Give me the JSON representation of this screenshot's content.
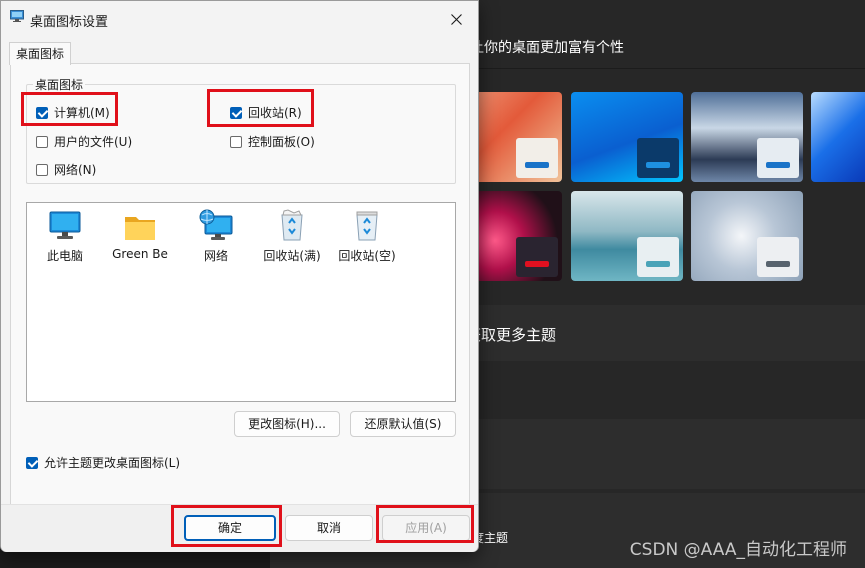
{
  "background": {
    "header_text": "让你的桌面更加富有个性",
    "more_themes": "获取更多主题",
    "contrast_themes": "对比度主题",
    "watermark": "CSDN @AAA_自动化工程师",
    "colors": {
      "panel": "#272727",
      "row": "#2d2d2d"
    },
    "themes": [
      {
        "name": "orange-theme",
        "bar": "#1a73c8",
        "card": "#f2eee8"
      },
      {
        "name": "blue-theme",
        "bar": "#1e90e0",
        "card": "#0b3a6a"
      },
      {
        "name": "mountain-theme",
        "bar": "#1a73c8",
        "card": "#e6ecf2"
      },
      {
        "name": "bloom-theme",
        "bar": "#1a73c8",
        "card": "#e9eef6"
      },
      {
        "name": "flower-theme",
        "bar": "#e01020",
        "card": "#2a2430"
      },
      {
        "name": "lake-theme",
        "bar": "#4aa3b8",
        "card": "#e8eff2"
      },
      {
        "name": "silver-theme",
        "bar": "#58636e",
        "card": "#edeff2"
      }
    ]
  },
  "dialog": {
    "title": "桌面图标设置",
    "tab": "桌面图标",
    "group_label": "桌面图标",
    "checkboxes": {
      "computer": {
        "label": "计算机(M)",
        "checked": true
      },
      "recycle_bin": {
        "label": "回收站(R)",
        "checked": true
      },
      "user_files": {
        "label": "用户的文件(U)",
        "checked": false
      },
      "control_panel": {
        "label": "控制面板(O)",
        "checked": false
      },
      "network": {
        "label": "网络(N)",
        "checked": false
      }
    },
    "icons": [
      {
        "label": "此电脑",
        "icon": "monitor-icon"
      },
      {
        "label": "Green Be",
        "icon": "folder-icon"
      },
      {
        "label": "网络",
        "icon": "network-icon"
      },
      {
        "label": "回收站(满)",
        "icon": "recycle-bin-full-icon"
      },
      {
        "label": "回收站(空)",
        "icon": "recycle-bin-empty-icon"
      }
    ],
    "change_icon_button": "更改图标(H)...",
    "restore_default_button": "还原默认值(S)",
    "allow_themes": {
      "label": "允许主题更改桌面图标(L)",
      "checked": true
    },
    "ok_button": "确定",
    "cancel_button": "取消",
    "apply_button": "应用(A)",
    "accent_color": "#005fb8",
    "highlight_color": "#e0101a"
  }
}
